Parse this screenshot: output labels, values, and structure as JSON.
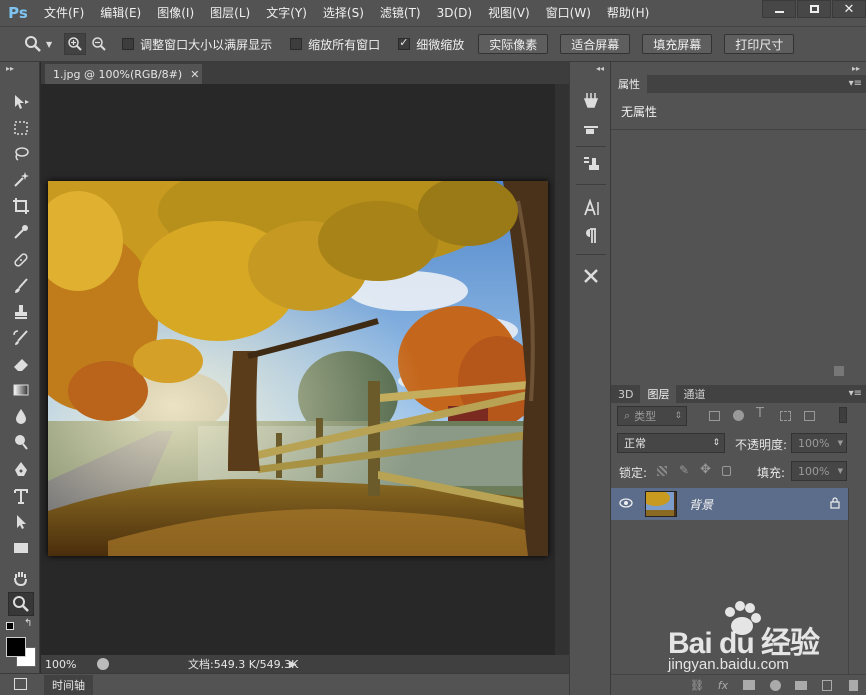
{
  "app": {
    "logo": "Ps"
  },
  "menu": [
    "文件(F)",
    "编辑(E)",
    "图像(I)",
    "图层(L)",
    "文字(Y)",
    "选择(S)",
    "滤镜(T)",
    "3D(D)",
    "视图(V)",
    "窗口(W)",
    "帮助(H)"
  ],
  "options": {
    "checkbox1": {
      "label": "调整窗口大小以满屏显示",
      "checked": false
    },
    "checkbox2": {
      "label": "缩放所有窗口",
      "checked": false
    },
    "checkbox3": {
      "label": "细微缩放",
      "checked": true
    },
    "buttons": [
      "实际像素",
      "适合屏幕",
      "填充屏幕",
      "打印尺寸"
    ]
  },
  "document": {
    "tab_title": "1.jpg @ 100%(RGB/8#)",
    "zoom": "100%",
    "doc_info": "文档:549.3 K/549.3K"
  },
  "timeline": {
    "label": "时间轴"
  },
  "properties": {
    "tab": "属性",
    "body": "无属性"
  },
  "layers": {
    "tabs": [
      "3D",
      "图层",
      "通道"
    ],
    "filter_kind": "类型",
    "blend_mode": "正常",
    "opacity_label": "不透明度:",
    "opacity_value": "100%",
    "lock_label": "锁定:",
    "fill_label": "填充:",
    "fill_value": "100%",
    "layer_name": "背景"
  },
  "watermark": {
    "brand": "Bai du 经验",
    "url": "jingyan.baidu.com"
  },
  "colors": {
    "ui_bg": "#535353",
    "canvas_bg": "#282828",
    "selected_layer": "#5b6d8a",
    "logo_blue": "#7ec4f2"
  }
}
